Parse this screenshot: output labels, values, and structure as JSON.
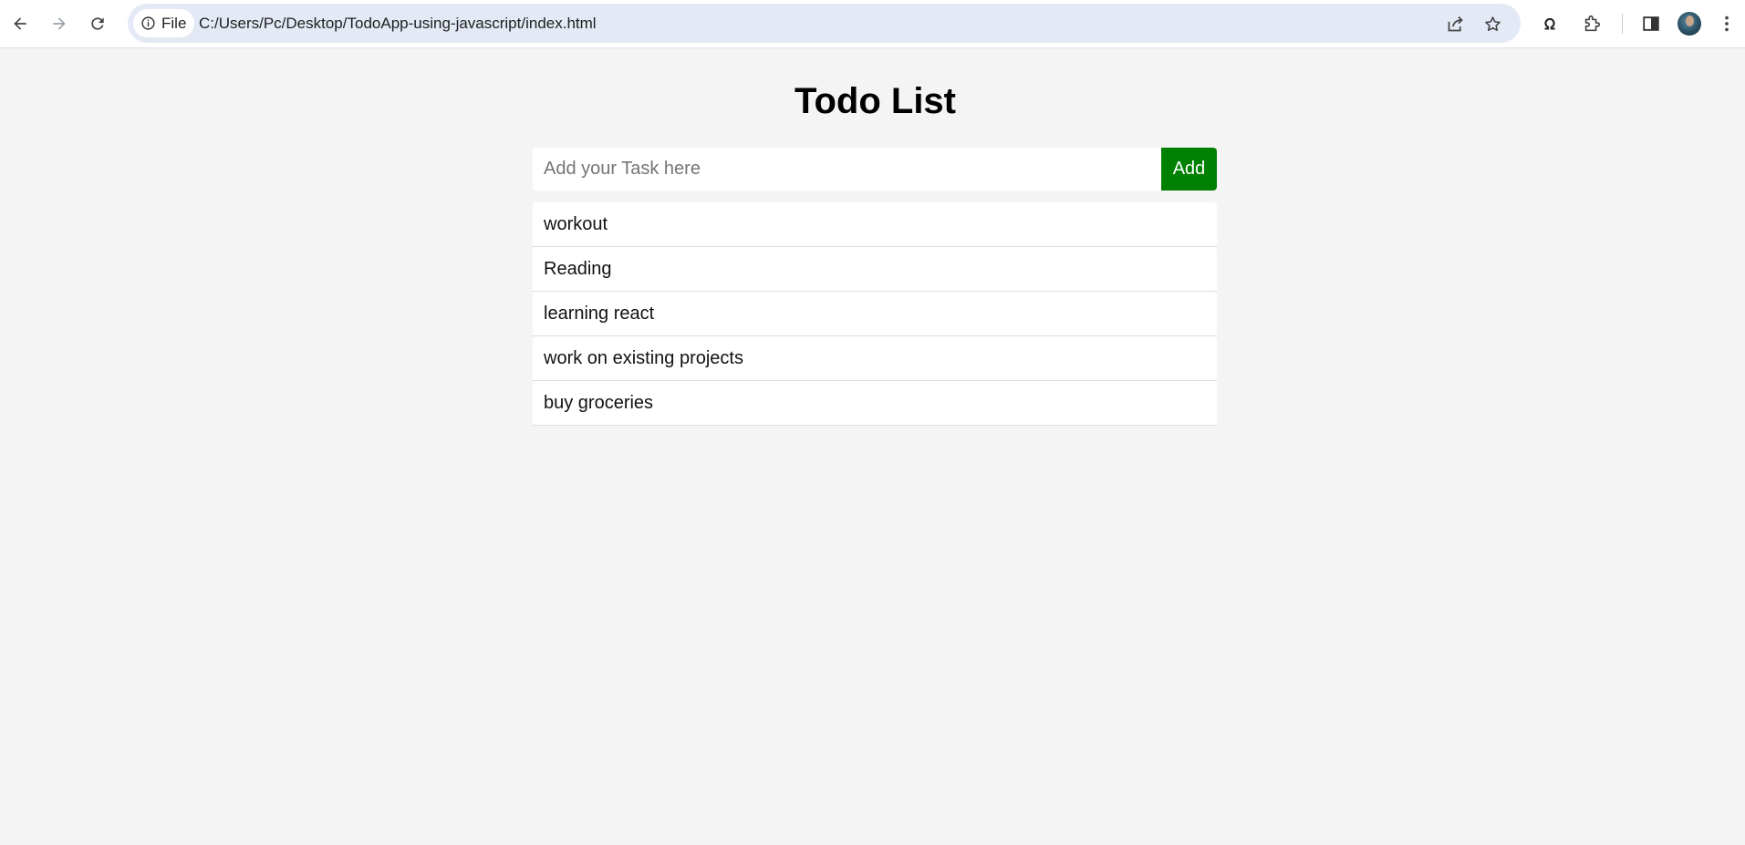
{
  "browser": {
    "file_chip_label": "File",
    "url": "C:/Users/Pc/Desktop/TodoApp-using-javascript/index.html"
  },
  "app": {
    "title": "Todo List",
    "input_placeholder": "Add your Task here",
    "input_value": "",
    "add_label": "Add",
    "tasks": [
      {
        "label": "workout"
      },
      {
        "label": "Reading"
      },
      {
        "label": "learning react"
      },
      {
        "label": "work on existing projects"
      },
      {
        "label": "buy groceries"
      }
    ]
  },
  "colors": {
    "page_background": "#f4f4f4",
    "add_button": "#008000",
    "omnibox": "#e3e9f5"
  }
}
